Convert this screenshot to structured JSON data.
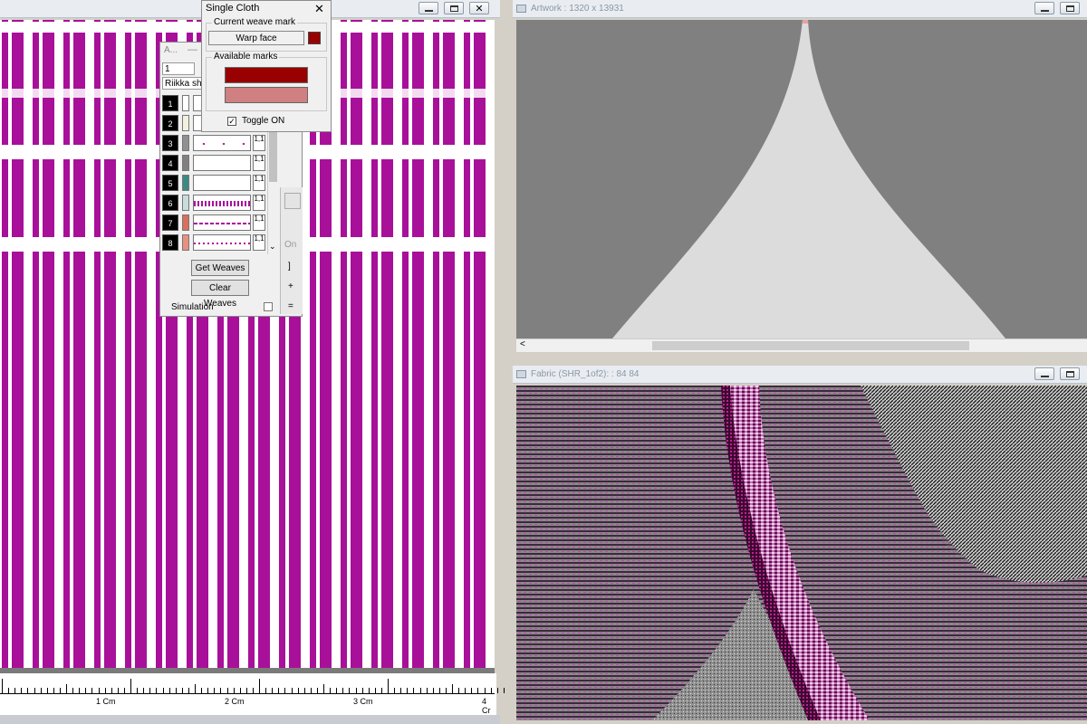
{
  "left_window": {
    "title": "",
    "pattern_color": "#a8109a"
  },
  "weave_dialog": {
    "title": "A...",
    "field_value": "1",
    "name_field": "Riikka shr",
    "rows": [
      {
        "num": "1",
        "swatch": "#ffffff",
        "tag": "1,1"
      },
      {
        "num": "2",
        "swatch": "#f4f0e0",
        "tag": "1,1"
      },
      {
        "num": "3",
        "swatch": "#909090",
        "tag": "1,1"
      },
      {
        "num": "4",
        "swatch": "#808080",
        "tag": "1,1"
      },
      {
        "num": "5",
        "swatch": "#3c8a84",
        "tag": "1,1"
      },
      {
        "num": "6",
        "swatch": "#c8dcdc",
        "tag": "1,1"
      },
      {
        "num": "7",
        "swatch": "#d8705c",
        "tag": "1,1"
      },
      {
        "num": "8",
        "swatch": "#e89080",
        "tag": "1,1"
      }
    ],
    "get_weaves": "Get Weaves",
    "clear_weaves": "Clear Weaves",
    "simulation": "Simulation",
    "side_on": "On"
  },
  "single_cloth": {
    "title": "Single Cloth",
    "close": "✕",
    "current_group": "Current weave mark",
    "current_mark": "Warp face",
    "current_color": "#990000",
    "available_group": "Available marks",
    "marks": [
      "#990000",
      "#d08080"
    ],
    "toggle_label": "Toggle ON",
    "toggle_checked": "✓"
  },
  "artwork_window": {
    "title": "Artwork : 1320 x 13931",
    "background": "#808080",
    "shape_color": "#dcdcdc",
    "scroll_left": "<"
  },
  "fabric_window": {
    "title": "Fabric (SHR_1of2):  :    84    84"
  },
  "ruler": {
    "labels": [
      "1 Cm",
      "2 Cm",
      "3 Cm",
      "4 Cr"
    ]
  }
}
